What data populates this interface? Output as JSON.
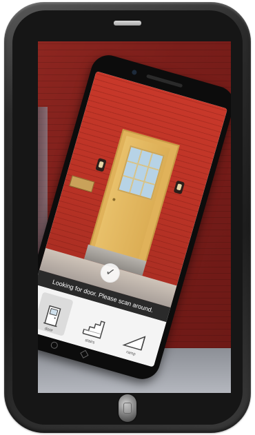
{
  "hint": {
    "text": "Looking for door. Please scan around."
  },
  "shelf": {
    "items": [
      {
        "name": "door",
        "label": "door",
        "icon": "door-icon",
        "selected": true
      },
      {
        "name": "stairs",
        "label": "stairs",
        "icon": "stairs-icon",
        "selected": false
      },
      {
        "name": "ramp",
        "label": "ramp",
        "icon": "ramp-icon",
        "selected": false
      }
    ]
  },
  "capture": {
    "icon": "checkmark-icon",
    "glyph": "✓"
  },
  "colors": {
    "device_body": "#1d1d1d",
    "brick": "#c8382a",
    "door": "#e0b25a",
    "hint_bar": "#2a2a2a"
  }
}
